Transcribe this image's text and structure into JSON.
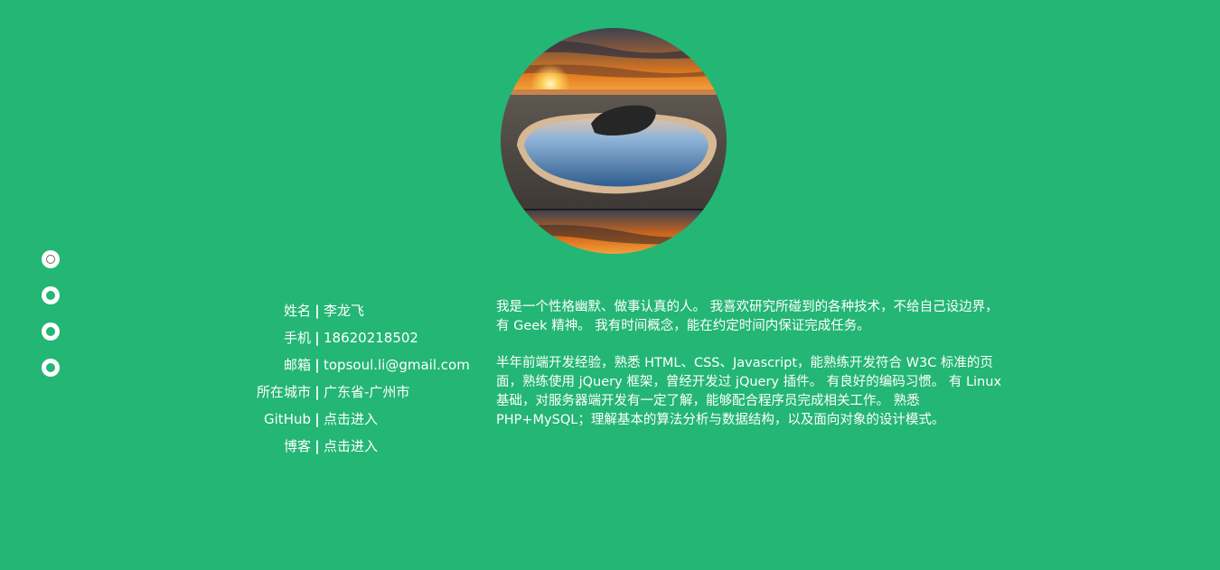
{
  "colors": {
    "background": "#23b674",
    "text": "#ffffff",
    "dot": "#ffffff",
    "dot_active_ring": "#6a6a6a"
  },
  "nav": {
    "dots": [
      {
        "name": "nav-dot-1",
        "active": true
      },
      {
        "name": "nav-dot-2",
        "active": false
      },
      {
        "name": "nav-dot-3",
        "active": false
      },
      {
        "name": "nav-dot-4",
        "active": false
      }
    ]
  },
  "avatar": {
    "alt": "sunset beach pool avatar"
  },
  "profile": {
    "separator": "|",
    "name": {
      "label": "姓名",
      "value": "李龙飞"
    },
    "phone": {
      "label": "手机",
      "value": "18620218502"
    },
    "email": {
      "label": "邮箱",
      "value": "topsoul.li@gmail.com"
    },
    "city": {
      "label": "所在城市",
      "value": "广东省-广州市"
    },
    "github": {
      "label": "GitHub",
      "value": "点击进入"
    },
    "blog": {
      "label": "博客",
      "value": "点击进入"
    }
  },
  "description": {
    "para1": "我是一个性格幽默、做事认真的人。 我喜欢研究所碰到的各种技术，不给自己设边界，有 Geek 精神。 我有时间概念，能在约定时间内保证完成任务。",
    "para2": "半年前端开发经验，熟悉 HTML、CSS、Javascript，能熟练开发符合 W3C 标准的页面，熟练使用 jQuery 框架，曾经开发过 jQuery 插件。 有良好的编码习惯。 有 Linux 基础，对服务器端开发有一定了解，能够配合程序员完成相关工作。 熟悉 PHP+MySQL；理解基本的算法分析与数据结构，以及面向对象的设计模式。"
  }
}
